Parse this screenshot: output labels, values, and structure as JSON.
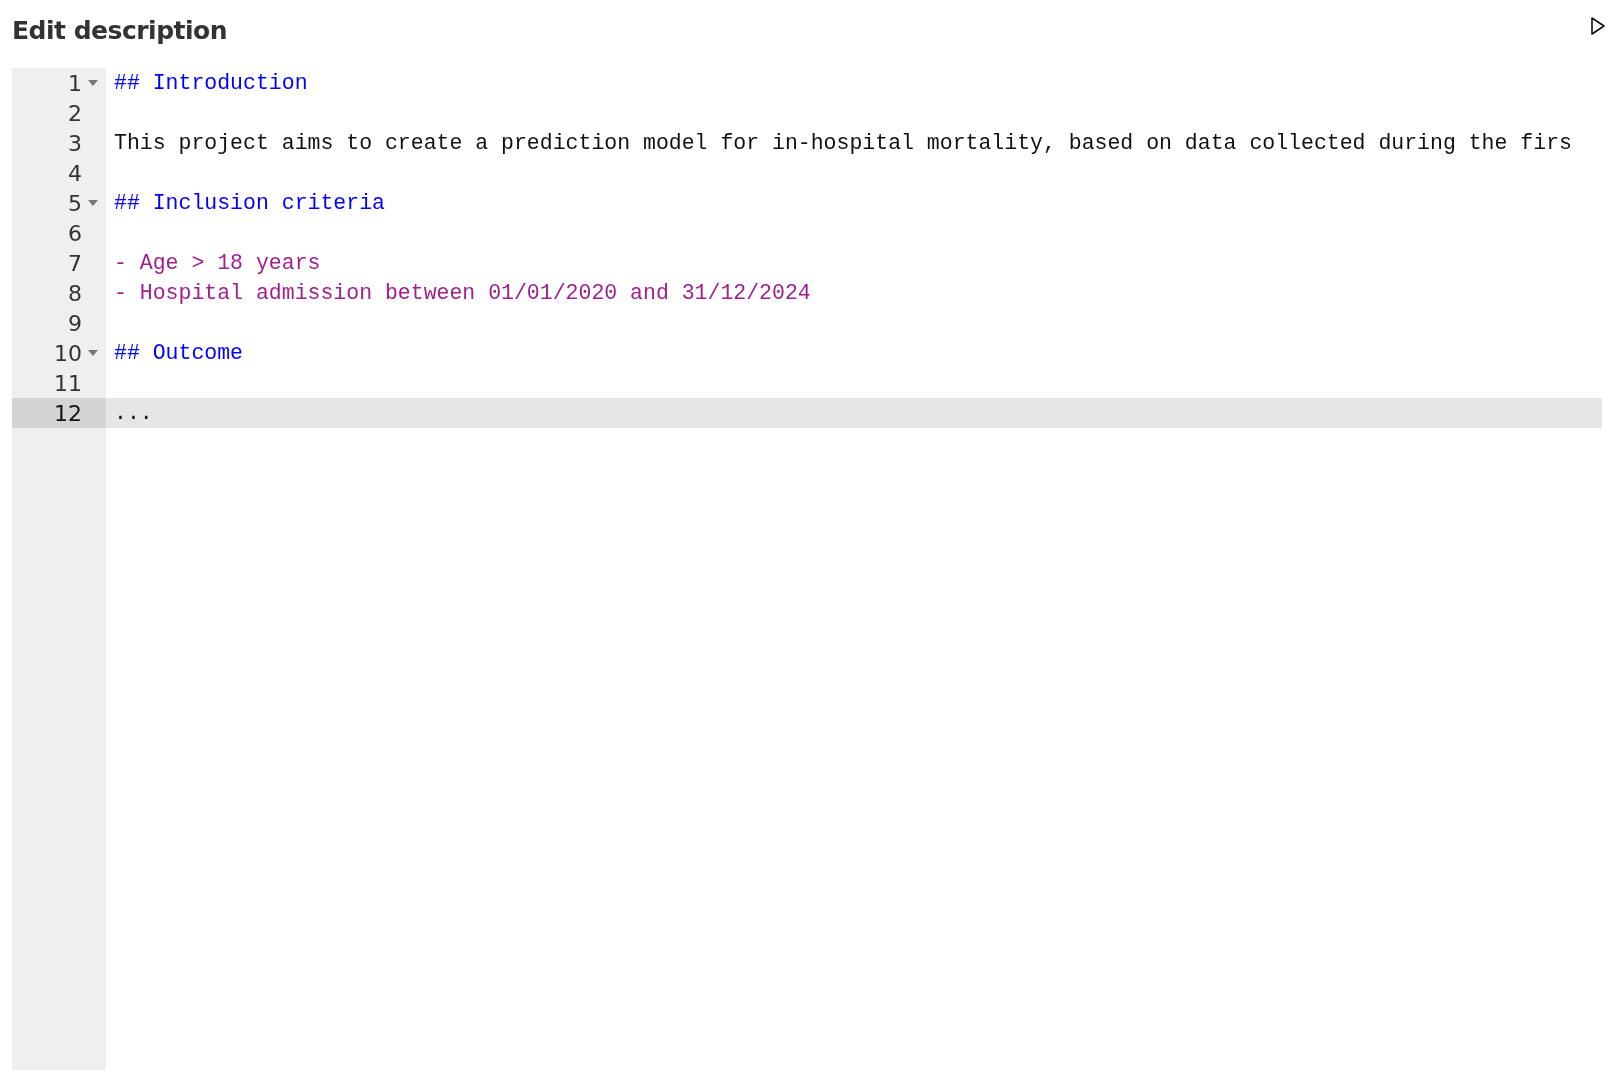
{
  "header": {
    "title": "Edit description"
  },
  "editor": {
    "lines": [
      {
        "number": "1",
        "kind": "heading",
        "text": "## Introduction",
        "foldable": true,
        "selected": false
      },
      {
        "number": "2",
        "kind": "blank",
        "foldable": false,
        "selected": false
      },
      {
        "number": "3",
        "kind": "text",
        "text": "This project aims to create a prediction model for in-hospital mortality, based on data collected during the firs",
        "foldable": false,
        "selected": false
      },
      {
        "number": "4",
        "kind": "blank",
        "foldable": false,
        "selected": false
      },
      {
        "number": "5",
        "kind": "heading",
        "text": "## Inclusion criteria",
        "foldable": true,
        "selected": false
      },
      {
        "number": "6",
        "kind": "blank",
        "foldable": false,
        "selected": false
      },
      {
        "number": "7",
        "kind": "list",
        "text": "- Age > 18 years",
        "foldable": false,
        "selected": false
      },
      {
        "number": "8",
        "kind": "list",
        "text": "- Hospital admission between 01/01/2020 and 31/12/2024",
        "foldable": false,
        "selected": false
      },
      {
        "number": "9",
        "kind": "blank",
        "foldable": false,
        "selected": false
      },
      {
        "number": "10",
        "kind": "heading",
        "text": "## Outcome",
        "foldable": true,
        "selected": false
      },
      {
        "number": "11",
        "kind": "blank",
        "foldable": false,
        "selected": false
      },
      {
        "number": "12",
        "kind": "text",
        "text": "...",
        "foldable": false,
        "selected": true
      }
    ]
  }
}
